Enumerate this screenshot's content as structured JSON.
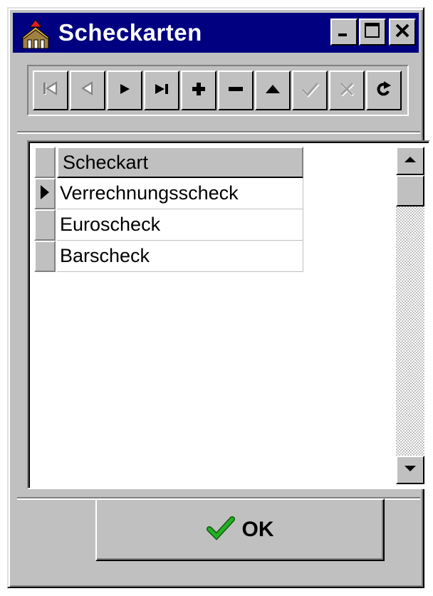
{
  "window": {
    "title": "Scheckarten",
    "controls": {
      "minimize": "minimize-icon",
      "maximize": "maximize-icon",
      "close": "close-icon"
    }
  },
  "navigator": {
    "buttons": [
      {
        "name": "first-record",
        "icon": "first-icon",
        "enabled": false
      },
      {
        "name": "prior-record",
        "icon": "prior-icon",
        "enabled": false
      },
      {
        "name": "next-record",
        "icon": "next-icon",
        "enabled": true
      },
      {
        "name": "last-record",
        "icon": "last-icon",
        "enabled": true
      },
      {
        "name": "insert-record",
        "icon": "plus-icon",
        "enabled": true
      },
      {
        "name": "delete-record",
        "icon": "minus-icon",
        "enabled": true
      },
      {
        "name": "edit-record",
        "icon": "up-triangle-icon",
        "enabled": true
      },
      {
        "name": "post-record",
        "icon": "check-icon",
        "enabled": false
      },
      {
        "name": "cancel-edit",
        "icon": "cross-icon",
        "enabled": false
      },
      {
        "name": "refresh-data",
        "icon": "refresh-icon",
        "enabled": true
      }
    ]
  },
  "grid": {
    "column_header": "Scheckart",
    "rows": [
      "Verrechnungsscheck",
      "Euroscheck",
      "Barscheck"
    ],
    "current_row": 0
  },
  "ok_button": {
    "label": "OK",
    "icon": "green-check-icon"
  },
  "colors": {
    "titlebar": "#000080",
    "face": "#c0c0c0",
    "check": "#1a9a1a"
  }
}
